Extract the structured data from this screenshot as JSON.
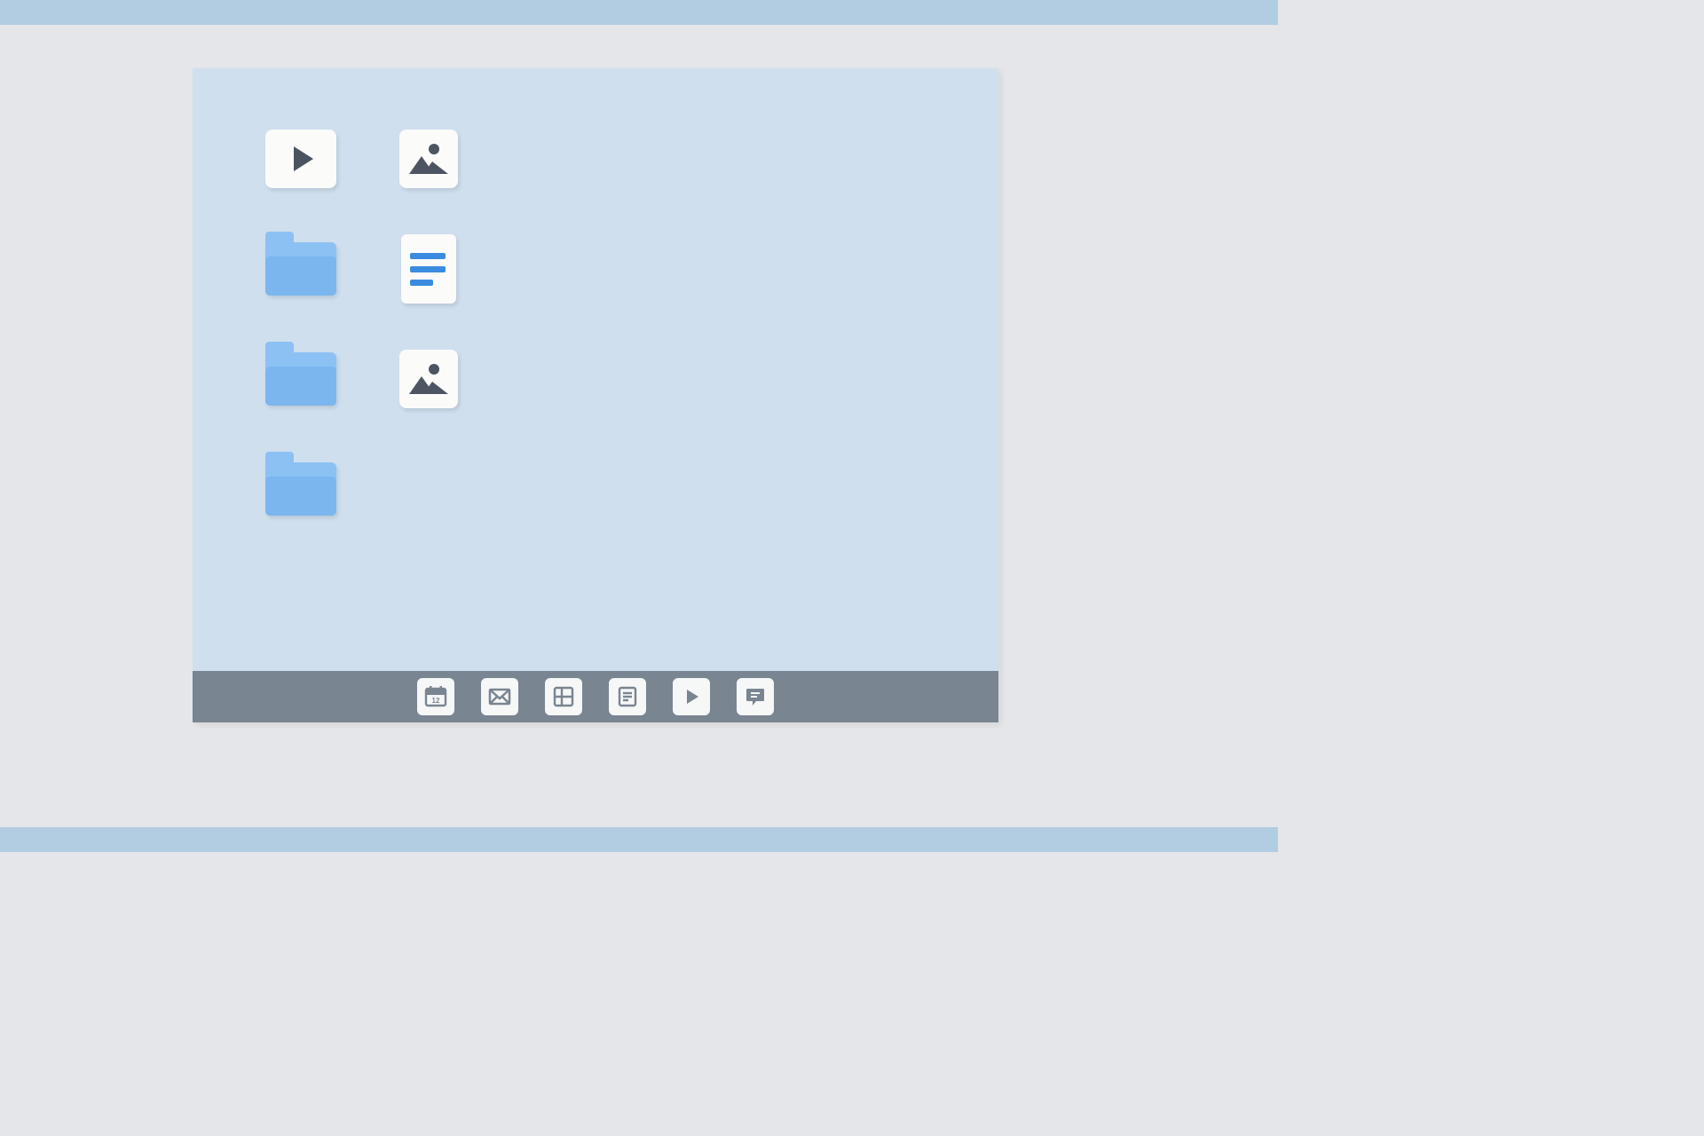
{
  "desktop": {
    "items": [
      {
        "type": "video",
        "icon": "play-icon"
      },
      {
        "type": "image",
        "icon": "image-icon"
      },
      {
        "type": "folder",
        "icon": "folder-icon"
      },
      {
        "type": "textdoc",
        "icon": "text-document-icon"
      },
      {
        "type": "folder",
        "icon": "folder-icon"
      },
      {
        "type": "image",
        "icon": "image-icon"
      },
      {
        "type": "folder",
        "icon": "folder-icon"
      }
    ]
  },
  "taskbar": {
    "apps": [
      {
        "name": "calendar-app",
        "icon": "calendar-icon"
      },
      {
        "name": "mail-app",
        "icon": "mail-icon"
      },
      {
        "name": "grid-app",
        "icon": "grid-icon"
      },
      {
        "name": "notes-app",
        "icon": "note-icon"
      },
      {
        "name": "media-app",
        "icon": "play-icon"
      },
      {
        "name": "chat-app",
        "icon": "chat-icon"
      }
    ]
  },
  "colors": {
    "page_bg": "#e4e6e9",
    "band": "#b2cce2",
    "window_bg": "#cfdfee",
    "taskbar_bg": "#798591",
    "tile_bg": "#fbfbfa",
    "folder_top": "#8cc1f4",
    "folder_front": "#7bb6ef",
    "glyph_dark": "#4c5561",
    "doc_line": "#3a8be0"
  }
}
